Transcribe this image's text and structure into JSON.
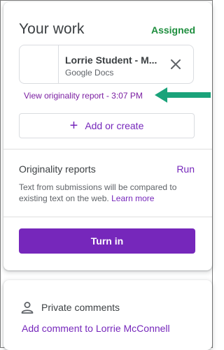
{
  "your_work": {
    "title": "Your work",
    "status": "Assigned",
    "attachment": {
      "name": "Lorrie Student - M...",
      "type": "Google Docs",
      "remove_icon": "close-icon"
    },
    "originality_link": "View originality report - 3:07 PM",
    "add_or_create": "Add or create",
    "originality": {
      "title": "Originality reports",
      "run": "Run",
      "description": "Text from submissions will be compared to existing text on the web.",
      "learn_more": "Learn more"
    },
    "turn_in": "Turn in"
  },
  "private_comments": {
    "title": "Private comments",
    "add_comment": "Add comment to Lorrie McConnell"
  },
  "colors": {
    "accent": "#7627bb",
    "assigned": "#1e8e3e",
    "annotation_arrow": "#1aa37a"
  }
}
